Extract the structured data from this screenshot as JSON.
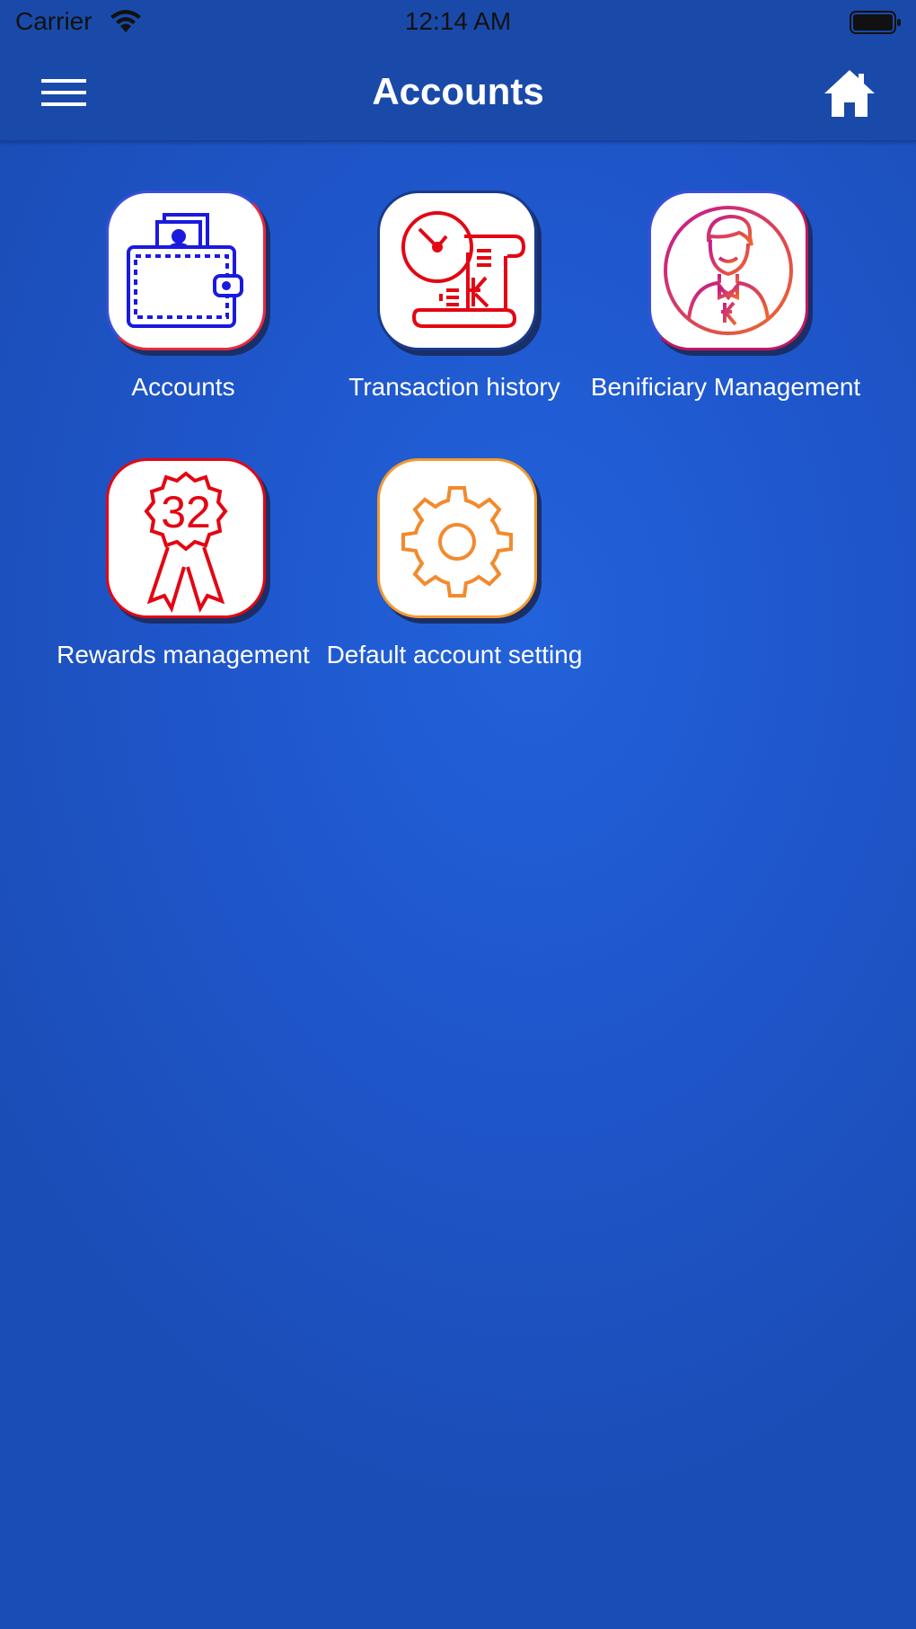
{
  "status_bar": {
    "carrier": "Carrier",
    "time": "12:14 AM"
  },
  "nav": {
    "title": "Accounts",
    "menu_icon": "hamburger-menu-icon",
    "home_icon": "home-icon"
  },
  "tiles": [
    {
      "label": "Accounts",
      "icon": "wallet-icon",
      "border_color": "#e8293c"
    },
    {
      "label": "Transaction history",
      "icon": "clock-receipt-icon",
      "border_color": "#1a3a8a"
    },
    {
      "label": "Benificiary Management",
      "icon": "beneficiary-person-icon",
      "border_color": "#c2185b"
    },
    {
      "label": "Rewards management",
      "icon": "reward-badge-icon",
      "badge_number": "32",
      "border_color": "#e30613"
    },
    {
      "label": "Default account setting",
      "icon": "gear-icon",
      "border_color": "#f39a2e"
    }
  ],
  "colors": {
    "nav_background": "#1a4aa9",
    "page_background": "#1f57cd",
    "wallet_blue": "#1a1adf",
    "history_red": "#e30613",
    "reward_red": "#e30613",
    "gear_orange": "#f28a2e"
  }
}
